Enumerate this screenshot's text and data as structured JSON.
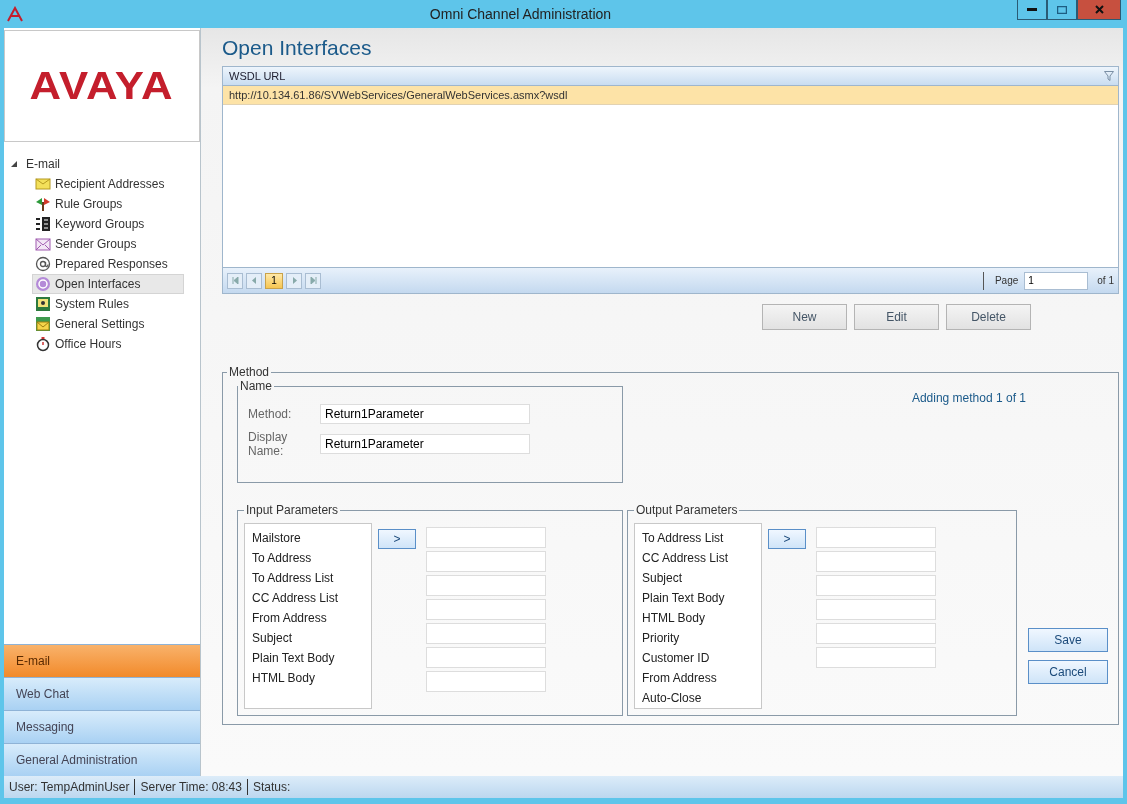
{
  "window": {
    "title": "Omni Channel Administration"
  },
  "sidebar": {
    "logo": "AVAYA",
    "tree": [
      {
        "label": "E-mail",
        "expanded": true,
        "children": [
          {
            "label": "Recipient Addresses",
            "selected": false
          },
          {
            "label": "Rule Groups",
            "selected": false
          },
          {
            "label": "Keyword Groups",
            "selected": false
          },
          {
            "label": "Sender Groups",
            "selected": false
          },
          {
            "label": "Prepared Responses",
            "selected": false
          },
          {
            "label": "Open Interfaces",
            "selected": true
          },
          {
            "label": "System Rules",
            "selected": false
          },
          {
            "label": "General Settings",
            "selected": false
          },
          {
            "label": "Office Hours",
            "selected": false
          }
        ]
      }
    ],
    "nav": [
      {
        "label": "E-mail",
        "selected": true
      },
      {
        "label": "Web Chat",
        "selected": false
      },
      {
        "label": "Messaging",
        "selected": false
      },
      {
        "label": "General Administration",
        "selected": false
      }
    ]
  },
  "page": {
    "title": "Open Interfaces"
  },
  "grid": {
    "columns": [
      "WSDL URL"
    ],
    "rows": [
      {
        "cells": [
          "http://10.134.61.86/SVWebServices/GeneralWebServices.asmx?wsdl"
        ],
        "selected": true
      }
    ],
    "pager": {
      "pages": [
        {
          "label": "1",
          "selected": true
        }
      ],
      "page_label": "Page",
      "page_value": "1",
      "page_total": "of 1"
    }
  },
  "grid_buttons": [
    "New",
    "Edit",
    "Delete"
  ],
  "method": {
    "legend": "Method",
    "name_group": {
      "legend": "Name",
      "fields": [
        {
          "label": "Method:",
          "value": "Return1Parameter"
        },
        {
          "label": "Display Name:",
          "value": "Return1Parameter"
        }
      ]
    },
    "progress_text": "Adding method 1 of 1",
    "parameter_groups": [
      {
        "legend": "Input Parameters",
        "items": [
          "Mailstore",
          "To Address",
          "To Address List",
          "CC Address List",
          "From Address",
          "Subject",
          "Plain Text Body",
          "HTML Body"
        ],
        "move_button": ">",
        "mapping_fields": [
          {
            "disabled": false
          },
          {
            "disabled": false
          },
          {
            "disabled": false
          },
          {
            "disabled": false
          },
          {
            "disabled": false
          },
          {
            "disabled": false
          },
          {
            "disabled": false
          }
        ]
      },
      {
        "legend": "Output Parameters",
        "items": [
          "To Address List",
          "CC Address List",
          "Subject",
          "Plain Text Body",
          "HTML Body",
          "Priority",
          "Customer ID",
          "From Address",
          "Auto-Close"
        ],
        "move_button": ">",
        "mapping_fields": [
          {
            "disabled": false
          },
          {
            "disabled": false
          },
          {
            "disabled": false
          },
          {
            "disabled": false
          },
          {
            "disabled": false
          },
          {
            "disabled": false
          }
        ]
      }
    ],
    "buttons": [
      "Save",
      "Cancel"
    ]
  },
  "status_bar": [
    "User: TempAdminUser",
    "Server Time: 08:43",
    "Status:"
  ]
}
